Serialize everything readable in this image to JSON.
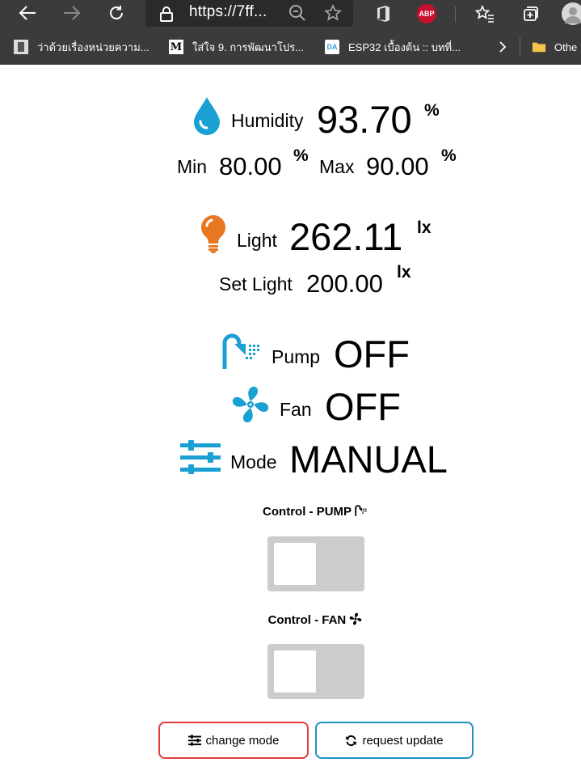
{
  "browser": {
    "url": "https://7ff...",
    "ext_abp_label": "ABP",
    "bookmarks": [
      {
        "label": "ว่าด้วยเรื่องหน่วยความ..."
      },
      {
        "label": "ใส่ใจ 9. การพัฒนาโปร...",
        "icon_letter": "M"
      },
      {
        "label": "ESP32 เบื้องต้น :: บทที่...",
        "icon_letter": "DA"
      },
      {
        "label": "Othe"
      }
    ]
  },
  "humidity": {
    "label": "Humidity",
    "value": "93.70",
    "unit": "%",
    "min_label": "Min",
    "min_value": "80.00",
    "min_unit": "%",
    "max_label": "Max",
    "max_value": "90.00",
    "max_unit": "%"
  },
  "light": {
    "label": "Light",
    "value": "262.11",
    "unit": "lx",
    "set_label": "Set Light",
    "set_value": "200.00",
    "set_unit": "lx"
  },
  "pump": {
    "label": "Pump",
    "state": "OFF"
  },
  "fan": {
    "label": "Fan",
    "state": "OFF"
  },
  "mode": {
    "label": "Mode",
    "state": "MANUAL"
  },
  "controls": {
    "pump_title": "Control - PUMP",
    "pump_on": false,
    "fan_title": "Control - FAN",
    "fan_on": false
  },
  "buttons": {
    "change_mode": "change mode",
    "request_update": "request update"
  },
  "colors": {
    "humidity_icon": "#1aa0d3",
    "light_icon": "#e87722",
    "device_icon": "#1aa0d3",
    "change_mode_border": "#e23b3b",
    "request_update_border": "#1f8fbf",
    "switch_off": "#cccccc",
    "chrome_bg": "#3b3b3b"
  },
  "icons": {
    "humidity": "water-drop-icon",
    "light": "light-bulb-icon",
    "pump": "shower-icon",
    "fan": "fan-icon",
    "mode": "sliders-icon",
    "change_mode": "sliders-icon",
    "request_update": "sync-icon"
  }
}
